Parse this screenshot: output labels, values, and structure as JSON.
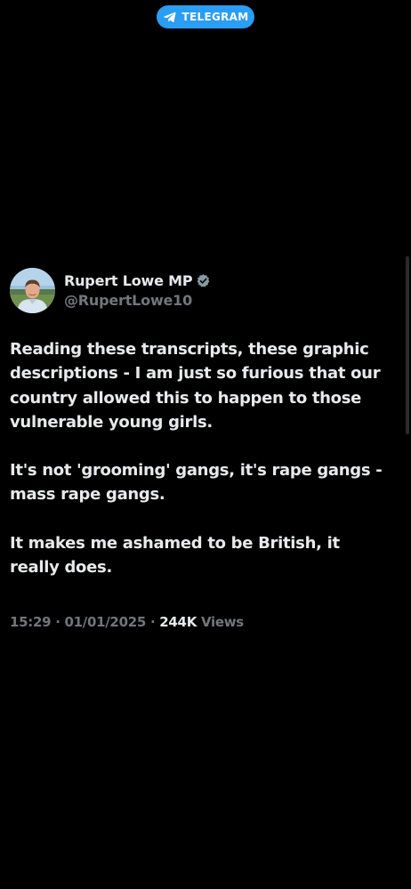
{
  "overlay": {
    "badge_label": "TELEGRAM",
    "badge_icon": "telegram-plane-icon",
    "badge_color": "#2a9df4"
  },
  "tweet": {
    "author": {
      "display_name": "Rupert Lowe MP",
      "handle": "@RupertLowe10",
      "verified": true,
      "verified_icon": "verified-badge-icon",
      "verified_color": "#8899a6"
    },
    "paragraphs": [
      "Reading these transcripts, these graphic descriptions - I am just so furious that our country allowed this to happen to those vulnerable young girls.",
      "It's not 'grooming' gangs, it's rape gangs - mass rape gangs.",
      "It makes me ashamed to be British, it really does."
    ],
    "time": "15:29",
    "date": "01/01/2025",
    "separator": "·",
    "views_count": "244K",
    "views_label": "Views"
  },
  "colors": {
    "background": "#000000",
    "primary_text": "#e7e9ea",
    "secondary_text": "#71767b"
  }
}
